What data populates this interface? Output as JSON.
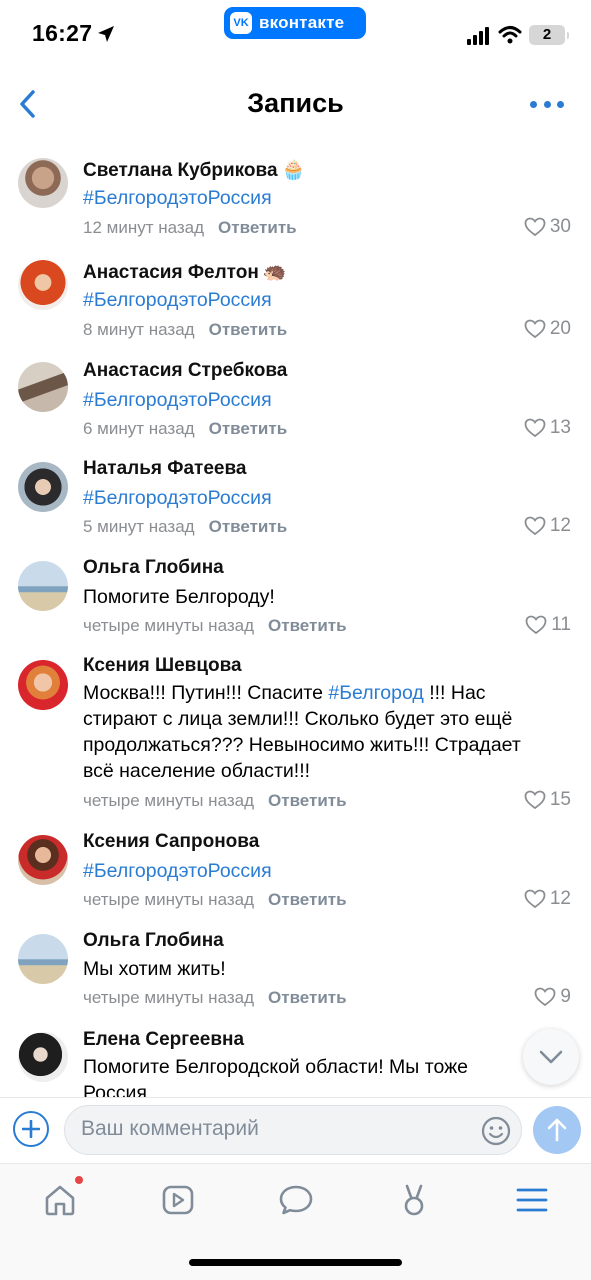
{
  "status_bar": {
    "time": "16:27",
    "app_badge": "вконтакте",
    "battery": "2"
  },
  "navbar": {
    "title": "Запись"
  },
  "comments": [
    {
      "author": "Светлана Кубрикова",
      "author_emoji": "🧁",
      "text": "",
      "hashtag": "#БелгородэтоРоссия",
      "time": "12 минут назад",
      "reply": "Ответить",
      "likes": "30"
    },
    {
      "author": "Анастасия Фелтон",
      "author_emoji": "🦔",
      "text": "",
      "hashtag": "#БелгородэтоРоссия",
      "time": "8 минут назад",
      "reply": "Ответить",
      "likes": "20"
    },
    {
      "author": "Анастасия Стребкова",
      "author_emoji": "",
      "text": "",
      "hashtag": "#БелгородэтоРоссия",
      "time": "6 минут назад",
      "reply": "Ответить",
      "likes": "13"
    },
    {
      "author": "Наталья Фатеева",
      "author_emoji": "",
      "text": "",
      "hashtag": "#БелгородэтоРоссия",
      "time": "5 минут назад",
      "reply": "Ответить",
      "likes": "12"
    },
    {
      "author": "Ольга Глобина",
      "author_emoji": "",
      "text": "Помогите Белгороду!",
      "hashtag": "",
      "time": "четыре минуты назад",
      "reply": "Ответить",
      "likes": "11"
    },
    {
      "author": "Ксения Шевцова",
      "author_emoji": "",
      "text_before": "Москва!!! Путин!!! Спасите ",
      "hashtag": "#Белгород",
      "text_after": " !!! Нас стирают с лица земли!!! Сколько будет это ещё продолжаться??? Невыносимо жить!!! Страдает всё население области!!!",
      "time": "четыре минуты назад",
      "reply": "Ответить",
      "likes": "15"
    },
    {
      "author": "Ксения Сапронова",
      "author_emoji": "",
      "text": "",
      "hashtag": "#БелгородэтоРоссия",
      "time": "четыре минуты назад",
      "reply": "Ответить",
      "likes": "12"
    },
    {
      "author": "Ольга Глобина",
      "author_emoji": "",
      "text": "Мы хотим жить!",
      "hashtag": "",
      "time": "четыре минуты назад",
      "reply": "Ответить",
      "likes": "9"
    },
    {
      "author": "Елена Сергеевна",
      "author_emoji": "",
      "text": "Помогите Белгородской области! Мы тоже Россия",
      "hashtag": "",
      "time": "",
      "reply": "",
      "likes": ""
    }
  ],
  "composer": {
    "placeholder": "Ваш комментарий"
  },
  "icons": {
    "back": "chevron-left-icon",
    "more": "more-dots-icon",
    "like": "heart-icon",
    "scroll": "chevron-down-icon",
    "add": "plus-circle-icon",
    "emoji": "smile-icon",
    "send": "arrow-up-icon",
    "tabs": [
      "home-icon",
      "video-icon",
      "messages-icon",
      "clips-icon",
      "menu-icon"
    ]
  },
  "colors": {
    "accent": "#2a7cd3",
    "vk_brand": "#0077ff",
    "meta": "#8a8d91",
    "send_disabled": "#a3c8f3"
  }
}
